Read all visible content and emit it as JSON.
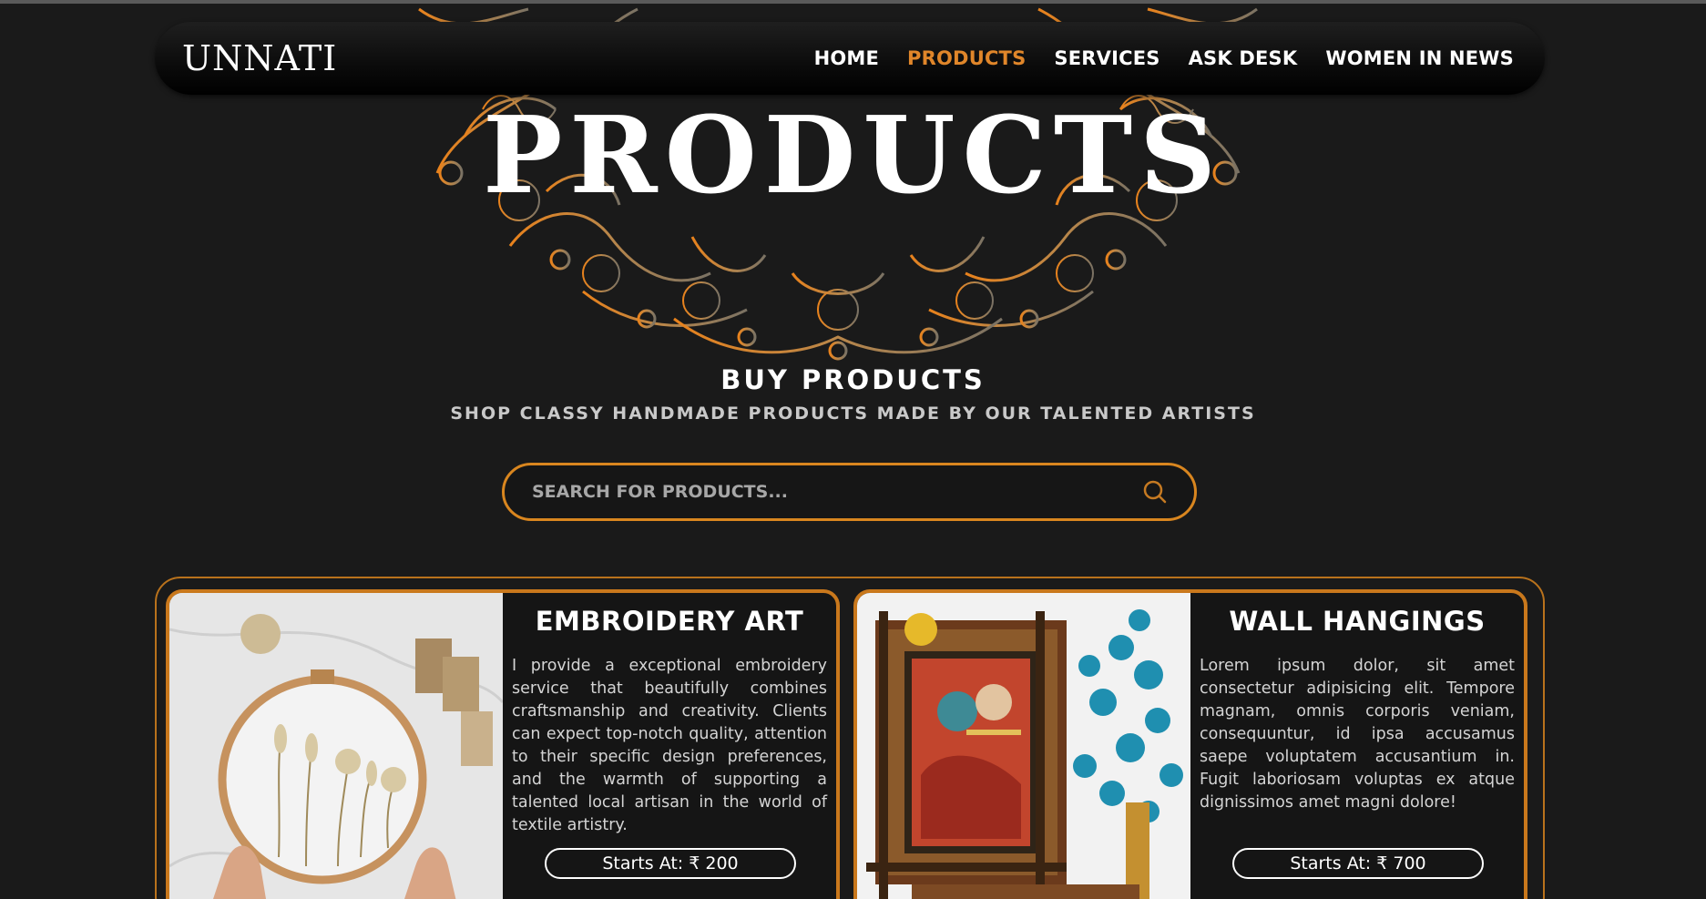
{
  "nav": {
    "logo": "UNNATI",
    "links": [
      "HOME",
      "PRODUCTS",
      "SERVICES",
      "ASK DESK",
      "WOMEN IN NEWS"
    ],
    "active": "PRODUCTS"
  },
  "hero": {
    "title": "PRODUCTS"
  },
  "section": {
    "title": "BUY PRODUCTS",
    "subtitle": "SHOP CLASSY HANDMADE PRODUCTS MADE BY OUR TALENTED ARTISTS"
  },
  "search": {
    "placeholder": "SEARCH FOR PRODUCTS...",
    "value": ""
  },
  "products": [
    {
      "title": "EMBROIDERY ART",
      "description": "I provide a exceptional embroidery service that beautifully combines craftsmanship and creativity. Clients can expect top-notch quality, attention to their specific design preferences, and the warmth of supporting a talented local artisan in the world of textile artistry.",
      "price": "Starts At: ₹ 200"
    },
    {
      "title": "WALL HANGINGS",
      "description": "Lorem ipsum dolor, sit amet consectetur adipisicing elit. Tempore magnam, omnis corporis veniam, consequuntur, id ipsa accusamus saepe voluptatem accusantium in. Fugit laboriosam voluptas ex atque dignissimos amet magni dolore!",
      "price": "Starts At: ₹ 700"
    }
  ],
  "colors": {
    "accent": "#e0862a",
    "background": "#1a1a1a",
    "card_border": "#c9781c"
  }
}
